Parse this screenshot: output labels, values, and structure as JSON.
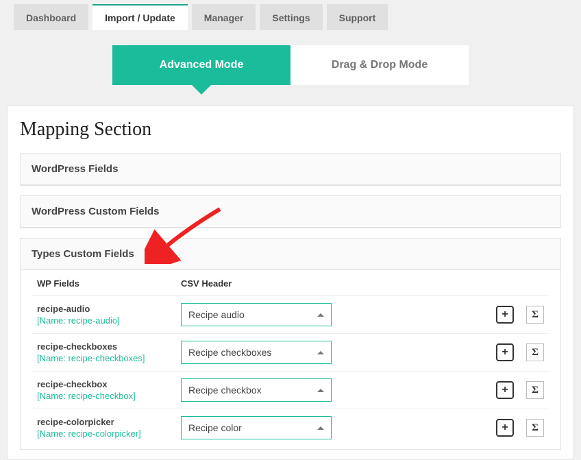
{
  "tabs": {
    "dashboard": "Dashboard",
    "import": "Import / Update",
    "manager": "Manager",
    "settings": "Settings",
    "support": "Support"
  },
  "modes": {
    "advanced": "Advanced Mode",
    "dragdrop": "Drag & Drop Mode"
  },
  "section_title": "Mapping Section",
  "accordions": {
    "wp_fields": "WordPress Fields",
    "wp_custom": "WordPress Custom Fields",
    "types_custom": "Types Custom Fields"
  },
  "columns": {
    "c1": "WP Fields",
    "c2": "CSV Header"
  },
  "icon_labels": {
    "plus": "+",
    "sigma": "Σ"
  },
  "rows": [
    {
      "title": "recipe-audio",
      "sub": "[Name: recipe-audio]",
      "select": "Recipe audio"
    },
    {
      "title": "recipe-checkboxes",
      "sub": "[Name: recipe-checkboxes]",
      "select": "Recipe checkboxes"
    },
    {
      "title": "recipe-checkbox",
      "sub": "[Name: recipe-checkbox]",
      "select": "Recipe checkbox"
    },
    {
      "title": "recipe-colorpicker",
      "sub": "[Name: recipe-colorpicker]",
      "select": "Recipe color"
    }
  ]
}
